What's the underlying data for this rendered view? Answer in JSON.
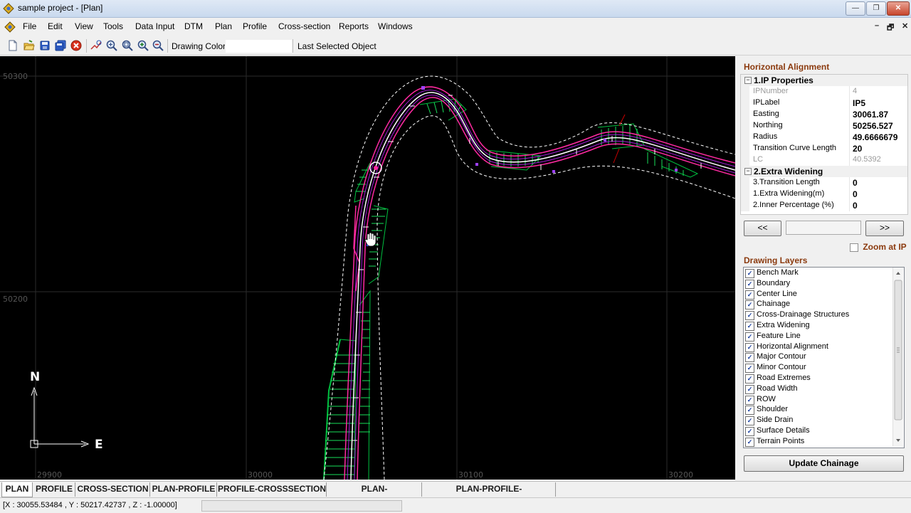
{
  "window": {
    "title": "sample project - [Plan]",
    "minimize": "0",
    "maximize": "1",
    "close": "r"
  },
  "menu": {
    "items": [
      "File",
      "Edit",
      "View",
      "Tools",
      "Data Input",
      "DTM",
      "Plan",
      "Profile",
      "Cross-section",
      "Reports",
      "Windows"
    ],
    "mdi_min": "–",
    "mdi_restore": "🗗",
    "mdi_close": "✕"
  },
  "toolbar": {
    "drawing_color_label": "Drawing Color",
    "last_selected_label": "Last Selected Object",
    "icons": [
      "new-icon",
      "open-icon",
      "save-icon",
      "save-all-icon",
      "close-red-icon",
      "zoom-extents-icon",
      "zoom-window-icon",
      "zoom-previous-icon",
      "zoom-in-icon",
      "zoom-out-icon"
    ]
  },
  "plan": {
    "grid": {
      "y_labels": [
        "50300",
        "50200"
      ],
      "x_labels": [
        "29900",
        "30000",
        "30100",
        "30200"
      ]
    },
    "compass": {
      "north": "N",
      "east": "E"
    },
    "colors": {
      "background": "#000000",
      "road_edge": "#ff2aa0",
      "side_slope": "#00c040",
      "centerline": "#ffffff",
      "extents": "#ffffff",
      "row_line": "#cc0000"
    }
  },
  "panel": {
    "title": "Horizontal Alignment",
    "categories": [
      {
        "label": "1.IP Properties",
        "properties": [
          {
            "key": "IPNumber",
            "value": "4",
            "readonly": true
          },
          {
            "key": "IPLabel",
            "value": "IP5",
            "readonly": false
          },
          {
            "key": "Easting",
            "value": "30061.87",
            "readonly": false
          },
          {
            "key": "Northing",
            "value": "50256.527",
            "readonly": false
          },
          {
            "key": "Radius",
            "value": "49.6666679",
            "readonly": false
          },
          {
            "key": "Transition Curve Length",
            "value": "20",
            "readonly": false
          },
          {
            "key": "LC",
            "value": "40.5392",
            "readonly": true
          }
        ]
      },
      {
        "label": "2.Extra Widening",
        "properties": [
          {
            "key": "3.Transition Length",
            "value": "0",
            "readonly": false
          },
          {
            "key": "1.Extra Widening(m)",
            "value": "0",
            "readonly": false
          },
          {
            "key": "2.Inner Percentage (%)",
            "value": "0",
            "readonly": false
          }
        ]
      }
    ],
    "prev_label": "<<",
    "next_label": ">>",
    "zoom_at_ip": "Zoom at IP",
    "layers_title": "Drawing Layers",
    "layers": [
      "Bench Mark",
      "Boundary",
      "Center Line",
      "Chainage",
      "Cross-Drainage Structures",
      "Extra Widening",
      "Feature Line",
      "Horizontal Alignment",
      "Major Contour",
      "Minor Contour",
      "Road Extremes",
      "Road Width",
      "ROW",
      "Shoulder",
      "Side Drain",
      "Surface Details",
      "Terrain Points"
    ],
    "update_label": "Update Chainage"
  },
  "tabs": [
    "PLAN",
    "PROFILE",
    "CROSS-SECTION",
    "PLAN-PROFILE",
    "PROFILE-CROSSSECTION",
    "PLAN-CROSSSECTION",
    "PLAN-PROFILE-CROSSSECTION"
  ],
  "status": {
    "coords": "[X : 30055.53484 , Y :  50217.42737 , Z : -1.00000]"
  }
}
